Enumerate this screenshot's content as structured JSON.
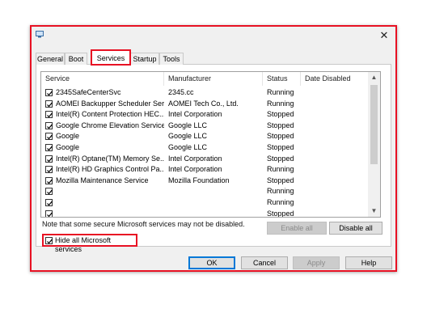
{
  "window": {
    "close_glyph": "✕"
  },
  "tabs": [
    {
      "label": "General"
    },
    {
      "label": "Boot"
    },
    {
      "label": "Services"
    },
    {
      "label": "Startup"
    },
    {
      "label": "Tools"
    }
  ],
  "columns": {
    "service": "Service",
    "manufacturer": "Manufacturer",
    "status": "Status",
    "date_disabled": "Date Disabled"
  },
  "rows": [
    {
      "service": "2345SafeCenterSvc",
      "manufacturer": "2345.cc",
      "status": "Running",
      "date_disabled": ""
    },
    {
      "service": "AOMEI Backupper Scheduler Ser...",
      "manufacturer": "AOMEI Tech Co., Ltd.",
      "status": "Running",
      "date_disabled": ""
    },
    {
      "service": "Intel(R) Content Protection HEC...",
      "manufacturer": "Intel Corporation",
      "status": "Stopped",
      "date_disabled": ""
    },
    {
      "service": "Google Chrome Elevation Service",
      "manufacturer": "Google LLC",
      "status": "Stopped",
      "date_disabled": ""
    },
    {
      "service": "Google",
      "manufacturer": "Google LLC",
      "status": "Stopped",
      "date_disabled": ""
    },
    {
      "service": "Google",
      "manufacturer": "Google LLC",
      "status": "Stopped",
      "date_disabled": ""
    },
    {
      "service": "Intel(R) Optane(TM) Memory Se...",
      "manufacturer": "Intel Corporation",
      "status": "Stopped",
      "date_disabled": ""
    },
    {
      "service": "Intel(R) HD Graphics Control Pa...",
      "manufacturer": "Intel Corporation",
      "status": "Running",
      "date_disabled": ""
    },
    {
      "service": "Mozilla Maintenance Service",
      "manufacturer": "Mozilla Foundation",
      "status": "Stopped",
      "date_disabled": ""
    },
    {
      "service": "",
      "manufacturer": "",
      "status": "Running",
      "date_disabled": ""
    },
    {
      "service": "",
      "manufacturer": "",
      "status": "Running",
      "date_disabled": ""
    },
    {
      "service": "",
      "manufacturer": "",
      "status": "Stopped",
      "date_disabled": ""
    }
  ],
  "note": "Note that some secure Microsoft services may not be disabled.",
  "buttons": {
    "enable_all": "Enable all",
    "disable_all": "Disable all",
    "ok": "OK",
    "cancel": "Cancel",
    "apply": "Apply",
    "help": "Help"
  },
  "hide_ms": {
    "label": "Hide all Microsoft services",
    "checked": true
  },
  "scroll": {
    "up": "▲",
    "down": "▼"
  }
}
